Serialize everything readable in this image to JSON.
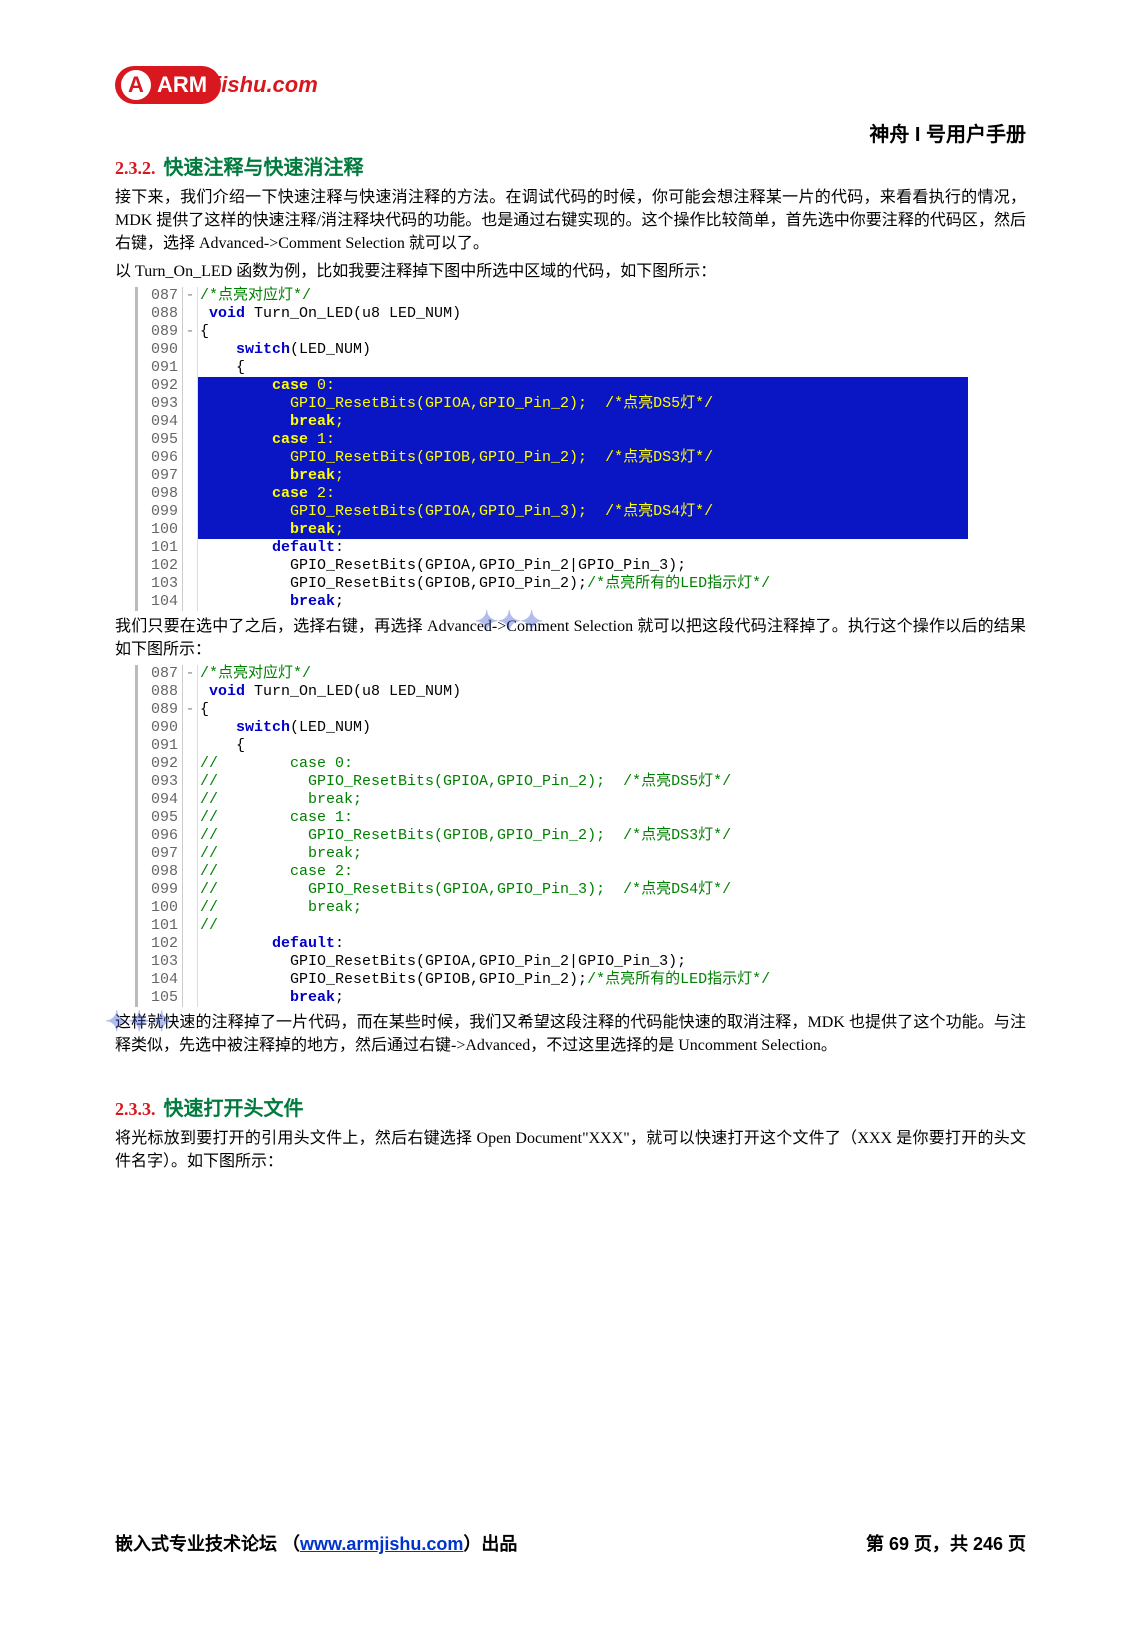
{
  "logo": {
    "arm": "ARM",
    "tail": "jishu.com"
  },
  "doc_title": "神舟 I 号用户手册",
  "s232": {
    "num": "2.3.2.",
    "title": "快速注释与快速消注释",
    "p1": "接下来，我们介绍一下快速注释与快速消注释的方法。在调试代码的时候，你可能会想注释某一片的代码，来看看执行的情况，MDK 提供了这样的快速注释/消注释块代码的功能。也是通过右键实现的。这个操作比较简单，首先选中你要注释的代码区，然后右键，选择 Advanced->Comment Selection 就可以了。",
    "p2": "以 Turn_On_LED 函数为例，比如我要注释掉下图中所选中区域的代码，如下图所示：",
    "p3": "我们只要在选中了之后，选择右键，再选择 Advanced->Comment Selection 就可以把这段代码注释掉了。执行这个操作以后的结果如下图所示：",
    "p4": "这样就快速的注释掉了一片代码，而在某些时候，我们又希望这段注释的代码能快速的取消注释，MDK 也提供了这个功能。与注释类似，先选中被注释掉的地方，然后通过右键->Advanced，不过这里选择的是 Uncomment Selection。"
  },
  "s233": {
    "num": "2.3.3.",
    "title": "快速打开头文件",
    "p1": "将光标放到要打开的引用头文件上，然后右键选择 Open Document\"XXX\"，就可以快速打开这个文件了（XXX 是你要打开的头文件名字）。如下图所示："
  },
  "code1": {
    "lines": [
      {
        "n": "087",
        "fold": "-",
        "cls": "",
        "html": "<span class='cmt'>/*点亮对应灯*/</span>"
      },
      {
        "n": "088",
        "fold": " ",
        "cls": "",
        "html": " <span class='kw'>void</span><span class='plain'> Turn_On_LED(u8 LED_NUM)</span>"
      },
      {
        "n": "089",
        "fold": "-",
        "cls": "",
        "html": "<span class='plain'>{</span>"
      },
      {
        "n": "090",
        "fold": " ",
        "cls": "",
        "html": "    <span class='kw'>switch</span><span class='plain'>(LED_NUM)</span>"
      },
      {
        "n": "091",
        "fold": " ",
        "cls": "",
        "html": "    <span class='plain'>{</span>"
      },
      {
        "n": "092",
        "fold": " ",
        "cls": "sel",
        "html": "        <span class='kw'>case</span> 0:"
      },
      {
        "n": "093",
        "fold": " ",
        "cls": "sel",
        "html": "          GPIO_ResetBits(GPIOA,GPIO_Pin_2);  <span class='cmt'>/*点亮DS5灯*/</span>"
      },
      {
        "n": "094",
        "fold": " ",
        "cls": "sel",
        "html": "          <span class='kw'>break</span>;"
      },
      {
        "n": "095",
        "fold": " ",
        "cls": "sel",
        "html": "        <span class='kw'>case</span> 1:"
      },
      {
        "n": "096",
        "fold": " ",
        "cls": "sel",
        "html": "          GPIO_ResetBits(GPIOB,GPIO_Pin_2);  <span class='cmt'>/*点亮DS3灯*/</span>"
      },
      {
        "n": "097",
        "fold": " ",
        "cls": "sel",
        "html": "          <span class='kw'>break</span>;"
      },
      {
        "n": "098",
        "fold": " ",
        "cls": "sel",
        "html": "        <span class='kw'>case</span> 2:"
      },
      {
        "n": "099",
        "fold": " ",
        "cls": "sel",
        "html": "          GPIO_ResetBits(GPIOA,GPIO_Pin_3);  <span class='cmt'>/*点亮DS4灯*/</span>"
      },
      {
        "n": "100",
        "fold": " ",
        "cls": "sel",
        "html": "          <span class='kw'>break</span>;          "
      },
      {
        "n": "101",
        "fold": " ",
        "cls": "",
        "html": "        <span class='kw'>default</span><span class='plain'>:</span>"
      },
      {
        "n": "102",
        "fold": " ",
        "cls": "",
        "html": "<span class='plain'>          GPIO_ResetBits(GPIOA,GPIO_Pin_2|GPIO_Pin_3);</span>"
      },
      {
        "n": "103",
        "fold": " ",
        "cls": "",
        "html": "<span class='plain'>          GPIO_ResetBits(GPIOB,GPIO_Pin_2);</span><span class='cmt'>/*点亮所有的LED指示灯*/</span>"
      },
      {
        "n": "104",
        "fold": " ",
        "cls": "",
        "html": "          <span class='kw'>break</span><span class='plain'>;</span>"
      }
    ]
  },
  "code2": {
    "lines": [
      {
        "n": "087",
        "fold": "-",
        "cls": "",
        "html": "<span class='cmt'>/*点亮对应灯*/</span>"
      },
      {
        "n": "088",
        "fold": " ",
        "cls": "",
        "html": " <span class='kw'>void</span><span class='plain'> Turn_On_LED(u8 LED_NUM)</span>"
      },
      {
        "n": "089",
        "fold": "-",
        "cls": "",
        "html": "<span class='plain'>{</span>"
      },
      {
        "n": "090",
        "fold": " ",
        "cls": "",
        "html": "    <span class='kw'>switch</span><span class='plain'>(LED_NUM)</span>"
      },
      {
        "n": "091",
        "fold": " ",
        "cls": "",
        "html": "    <span class='plain'>{</span>"
      },
      {
        "n": "092",
        "fold": " ",
        "cls": "",
        "html": "<span class='cmt'>//        case 0:</span>"
      },
      {
        "n": "093",
        "fold": " ",
        "cls": "",
        "html": "<span class='cmt'>//          GPIO_ResetBits(GPIOA,GPIO_Pin_2);  /*点亮DS5灯*/</span>"
      },
      {
        "n": "094",
        "fold": " ",
        "cls": "",
        "html": "<span class='cmt'>//          break;</span>"
      },
      {
        "n": "095",
        "fold": " ",
        "cls": "",
        "html": "<span class='cmt'>//        case 1:</span>"
      },
      {
        "n": "096",
        "fold": " ",
        "cls": "",
        "html": "<span class='cmt'>//          GPIO_ResetBits(GPIOB,GPIO_Pin_2);  /*点亮DS3灯*/</span>"
      },
      {
        "n": "097",
        "fold": " ",
        "cls": "",
        "html": "<span class='cmt'>//          break;</span>"
      },
      {
        "n": "098",
        "fold": " ",
        "cls": "",
        "html": "<span class='cmt'>//        case 2:</span>"
      },
      {
        "n": "099",
        "fold": " ",
        "cls": "",
        "html": "<span class='cmt'>//          GPIO_ResetBits(GPIOA,GPIO_Pin_3);  /*点亮DS4灯*/</span>"
      },
      {
        "n": "100",
        "fold": " ",
        "cls": "",
        "html": "<span class='cmt'>//          break;</span>"
      },
      {
        "n": "101",
        "fold": " ",
        "cls": "",
        "html": "<span class='cmt'>//</span>"
      },
      {
        "n": "102",
        "fold": " ",
        "cls": "",
        "html": "        <span class='kw'>default</span><span class='plain'>:</span>"
      },
      {
        "n": "103",
        "fold": " ",
        "cls": "",
        "html": "<span class='plain'>          GPIO_ResetBits(GPIOA,GPIO_Pin_2|GPIO_Pin_3);</span>"
      },
      {
        "n": "104",
        "fold": " ",
        "cls": "",
        "html": "<span class='plain'>          GPIO_ResetBits(GPIOB,GPIO_Pin_2);</span><span class='cmt'>/*点亮所有的LED指示灯*/</span>"
      },
      {
        "n": "105",
        "fold": " ",
        "cls": "",
        "html": "          <span class='kw'>break</span><span class='plain'>;</span>"
      }
    ]
  },
  "footer": {
    "left_a": "嵌入式专业技术论坛 （",
    "link": "www.armjishu.com",
    "left_b": "）出品",
    "right": "第 69 页，共 246 页"
  }
}
